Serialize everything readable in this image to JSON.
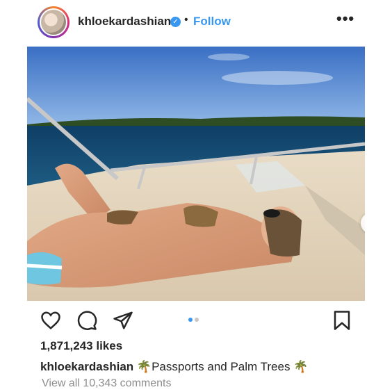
{
  "post": {
    "username": "khloekardashian",
    "verified_icon": "verified-check-icon",
    "separator": "•",
    "follow_label": "Follow",
    "more_label": "•••",
    "carousel": {
      "total": 2,
      "active_index": 0,
      "next_label": "›"
    },
    "likes": "1,871,243 likes",
    "caption": {
      "username": "khloekardashian",
      "text": "🌴Passports and Palm Trees 🌴"
    },
    "view_comments": "View all 10,343 comments"
  },
  "colors": {
    "accent": "#3897f0",
    "muted": "#8e8e8e",
    "text": "#262626"
  }
}
